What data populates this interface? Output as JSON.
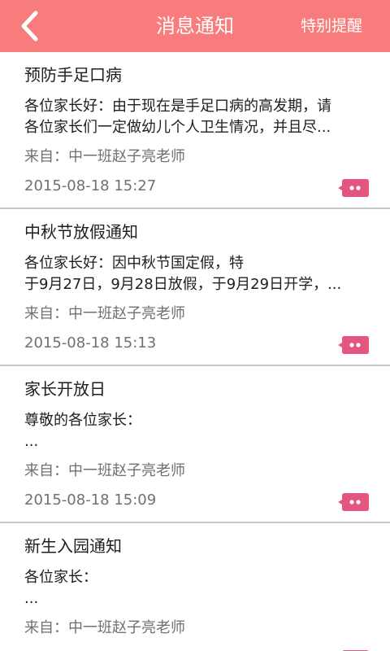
{
  "header": {
    "title": "消息通知",
    "action_label": "特别提醒"
  },
  "colors": {
    "header_bg": "#f87c7c",
    "icon_pink": "#e4567f"
  },
  "icons": {
    "back": "chevron-left-icon",
    "message": "chat-bubble-icon"
  },
  "notices": [
    {
      "title": "预防手足口病",
      "body_line1": "各位家长好：由于现在是手足口病的高发期，请",
      "body_line2": "各位家长们一定做幼儿个人卫生情况，并且尽...",
      "from": "来自：中一班赵子亮老师",
      "time": "2015-08-18 15:27"
    },
    {
      "title": "中秋节放假通知",
      "body_line1": "各位家长好：因中秋节国定假，特",
      "body_line2": "于9月27日，9月28日放假，于9月29日开学，...",
      "from": "来自：中一班赵子亮老师",
      "time": "2015-08-18 15:13"
    },
    {
      "title": "家长开放日",
      "body_line1": "尊敬的各位家长：",
      "body_line2": "...",
      "from": "来自：中一班赵子亮老师",
      "time": "2015-08-18 15:09"
    },
    {
      "title": "新生入园通知",
      "body_line1": "各位家长：",
      "body_line2": "...",
      "from": "来自：中一班赵子亮老师",
      "time": ""
    }
  ]
}
